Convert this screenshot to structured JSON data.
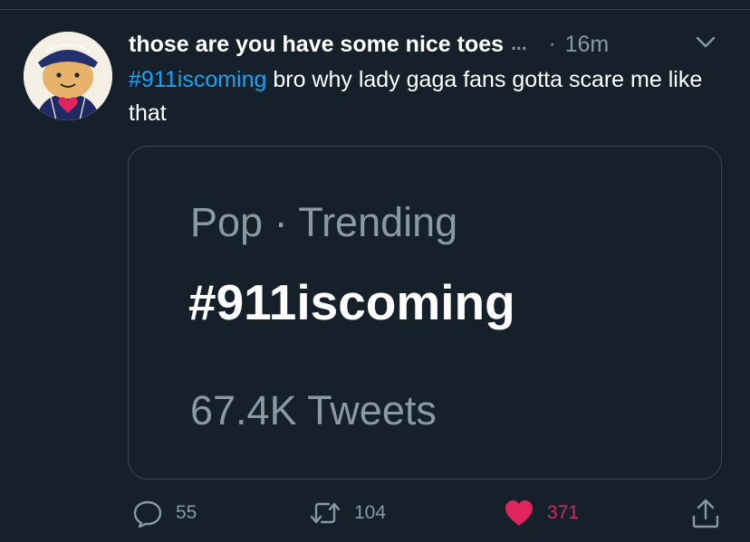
{
  "tweet": {
    "display_name": "those are you have some nice toes",
    "truncation": "...",
    "separator": "·",
    "timestamp": "16m",
    "text_hashtag": "#911iscoming",
    "text_body": " bro why lady gaga fans gotta scare me like that"
  },
  "card": {
    "category": "Pop · Trending",
    "hashtag": "#911iscoming",
    "tweet_count": "67.4K Tweets"
  },
  "actions": {
    "replies": "55",
    "retweets": "104",
    "likes": "371"
  },
  "colors": {
    "background": "#15202b",
    "link": "#1da1f2",
    "secondary_text": "#8899a6",
    "like": "#e0245e"
  },
  "icons": {
    "reply": "reply-icon",
    "retweet": "retweet-icon",
    "like": "heart-icon",
    "share": "share-icon",
    "menu": "chevron-down-icon"
  }
}
